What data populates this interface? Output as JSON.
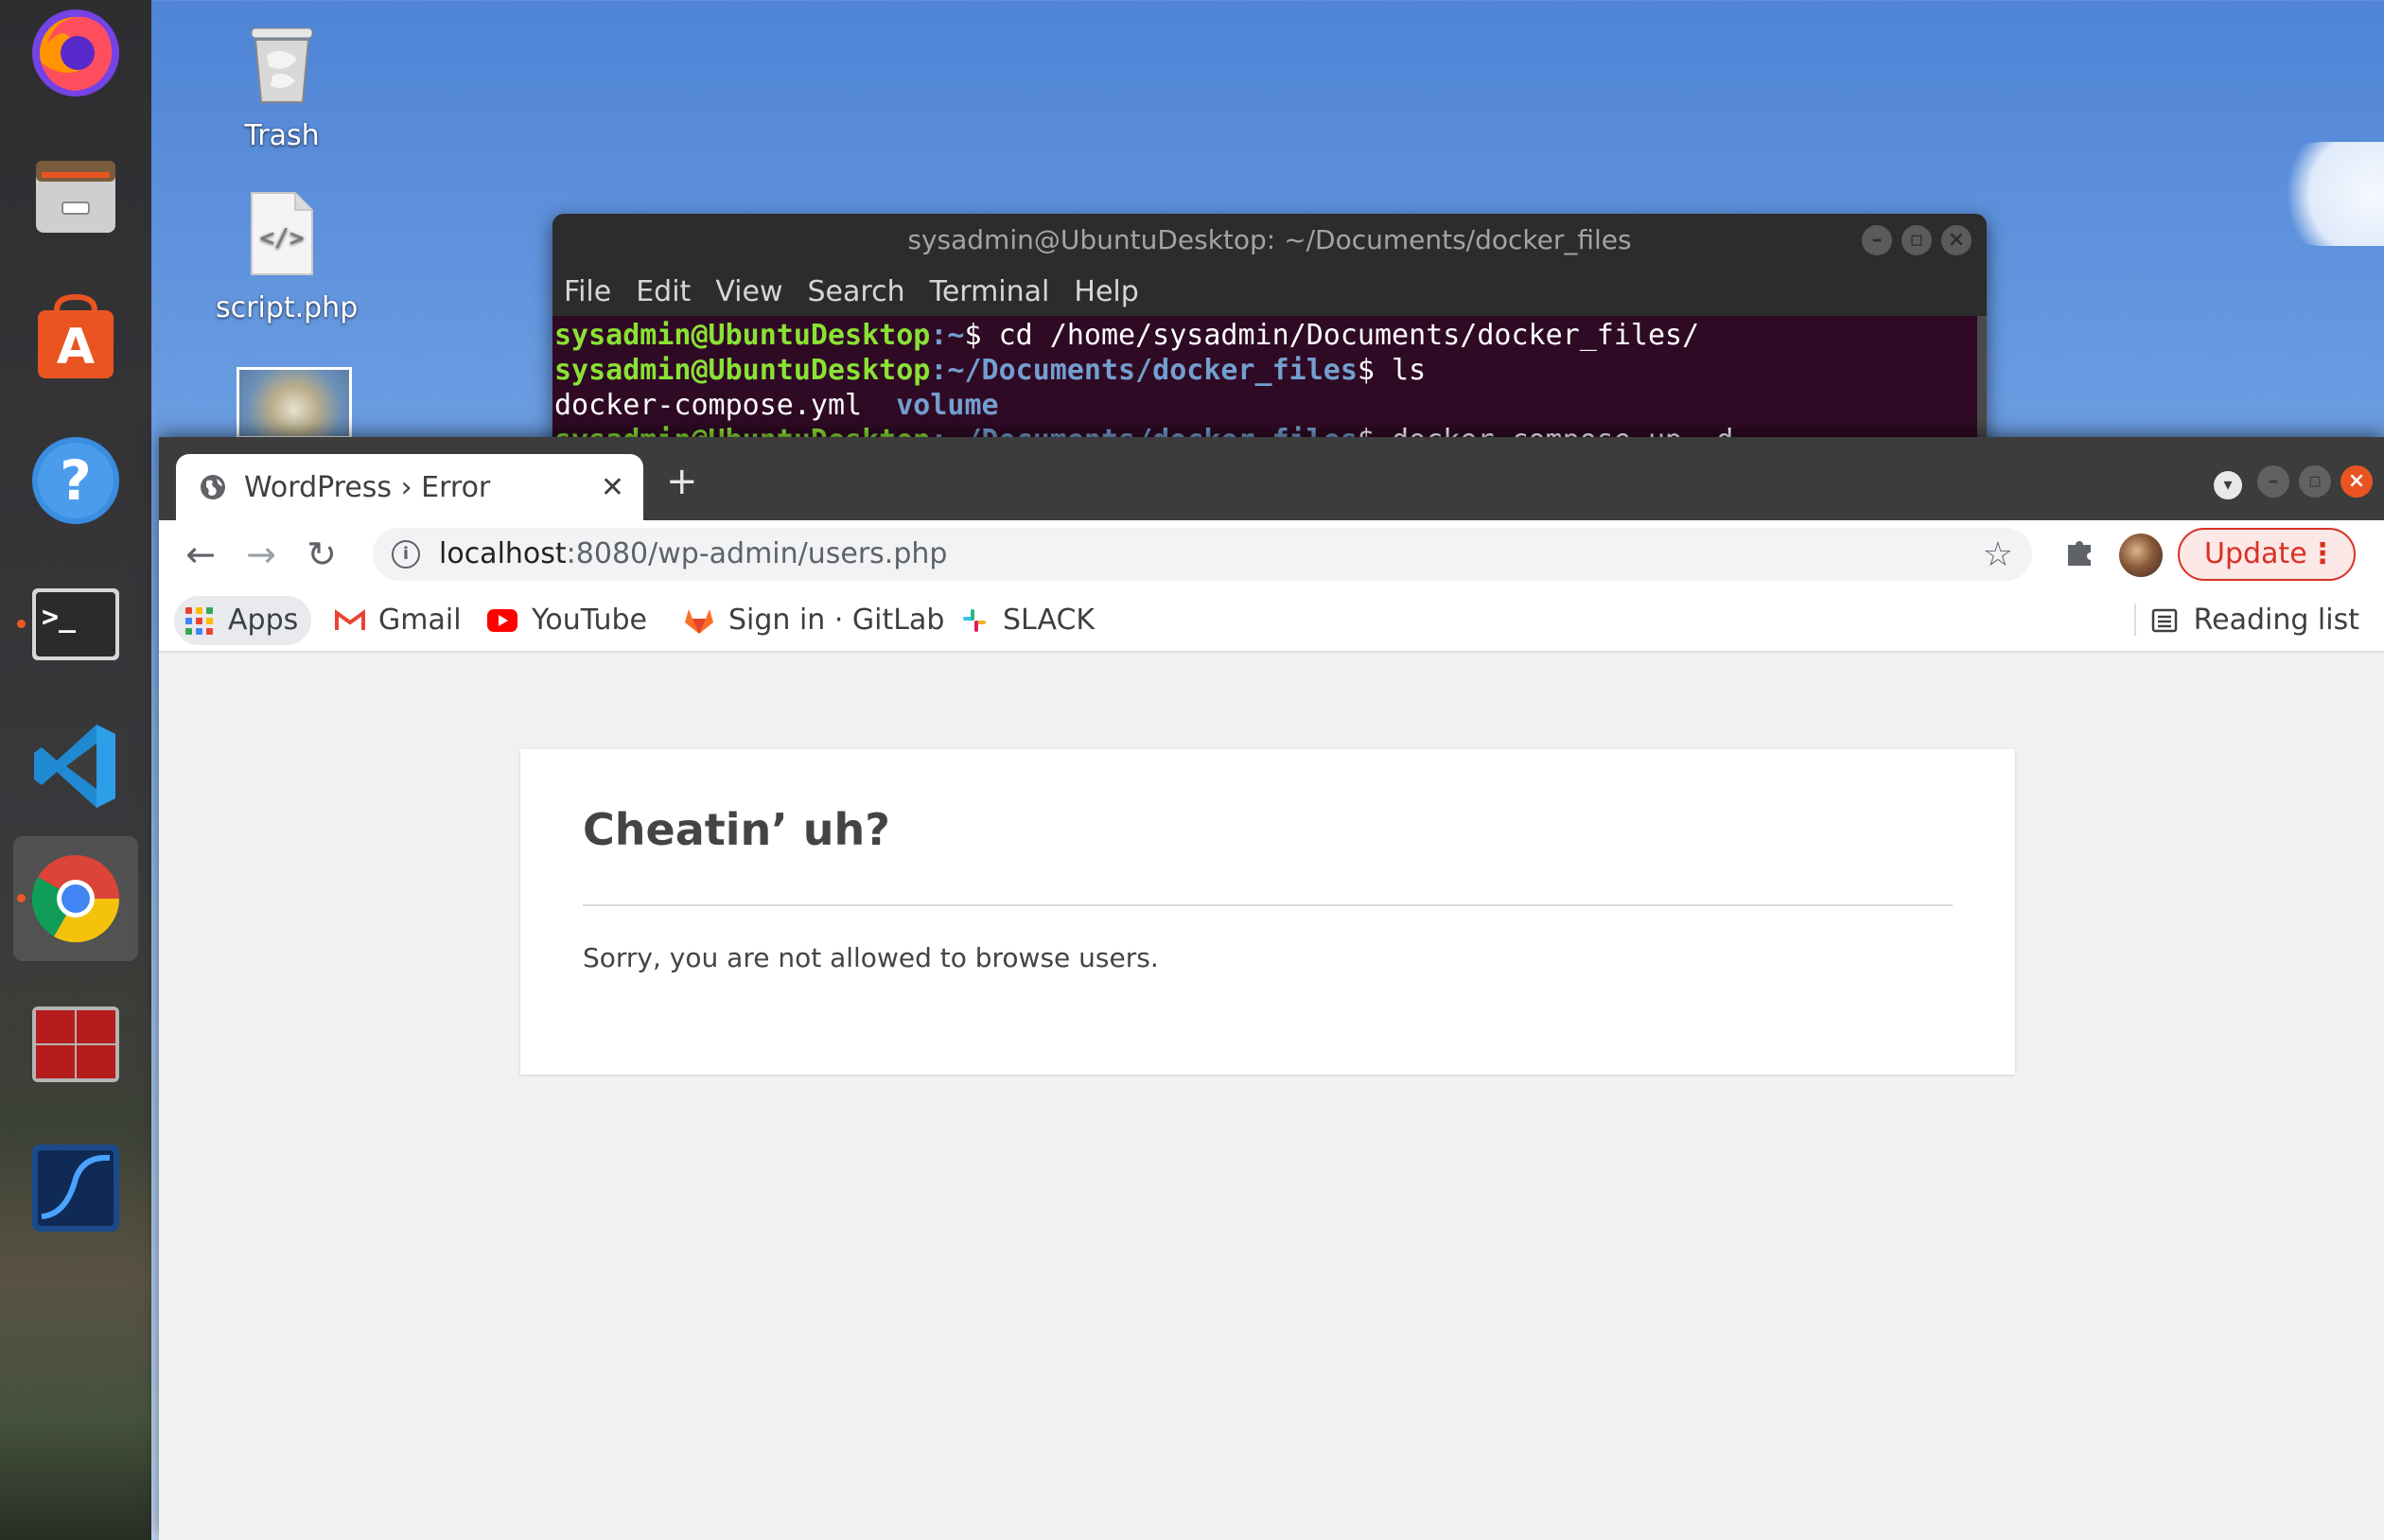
{
  "desktop": {
    "icons": [
      {
        "label": "Trash"
      },
      {
        "label": "script.php"
      }
    ]
  },
  "dock": {
    "items": [
      "Firefox",
      "Files",
      "Ubuntu Software",
      "Help",
      "Terminal",
      "Visual Studio Code",
      "Google Chrome",
      "Terminator",
      "Wireshark"
    ]
  },
  "terminal": {
    "title": "sysadmin@UbuntuDesktop: ~/Documents/docker_files",
    "menu": [
      "File",
      "Edit",
      "View",
      "Search",
      "Terminal",
      "Help"
    ],
    "lines": [
      {
        "user": "sysadmin@UbuntuDesktop",
        "path": ":~",
        "cmd": "$ cd /home/sysadmin/Documents/docker_files/"
      },
      {
        "user": "sysadmin@UbuntuDesktop",
        "path": ":~/Documents/docker_files",
        "cmd": "$ ls"
      },
      {
        "out": "docker-compose.yml  ",
        "dir": "volume"
      },
      {
        "user": "sysadmin@UbuntuDesktop",
        "path": ":~/Documents/docker_files",
        "cmd": "$ docker-compose up -d"
      }
    ]
  },
  "browser": {
    "tab_title": "WordPress › Error",
    "url_host": "localhost",
    "url_rest": ":8080/wp-admin/users.php",
    "update_label": "Update",
    "bookmarks": [
      "Apps",
      "Gmail",
      "YouTube",
      "Sign in · GitLab",
      "SLACK"
    ],
    "reading_list": "Reading list"
  },
  "page": {
    "heading": "Cheatin’ uh?",
    "message": "Sorry, you are not allowed to browse users."
  },
  "colors": {
    "terminal_bg": "#2f0a24",
    "prompt_user": "#8ae234",
    "prompt_path": "#729fcf",
    "update_red": "#d93025",
    "close_orange": "#e95420"
  }
}
